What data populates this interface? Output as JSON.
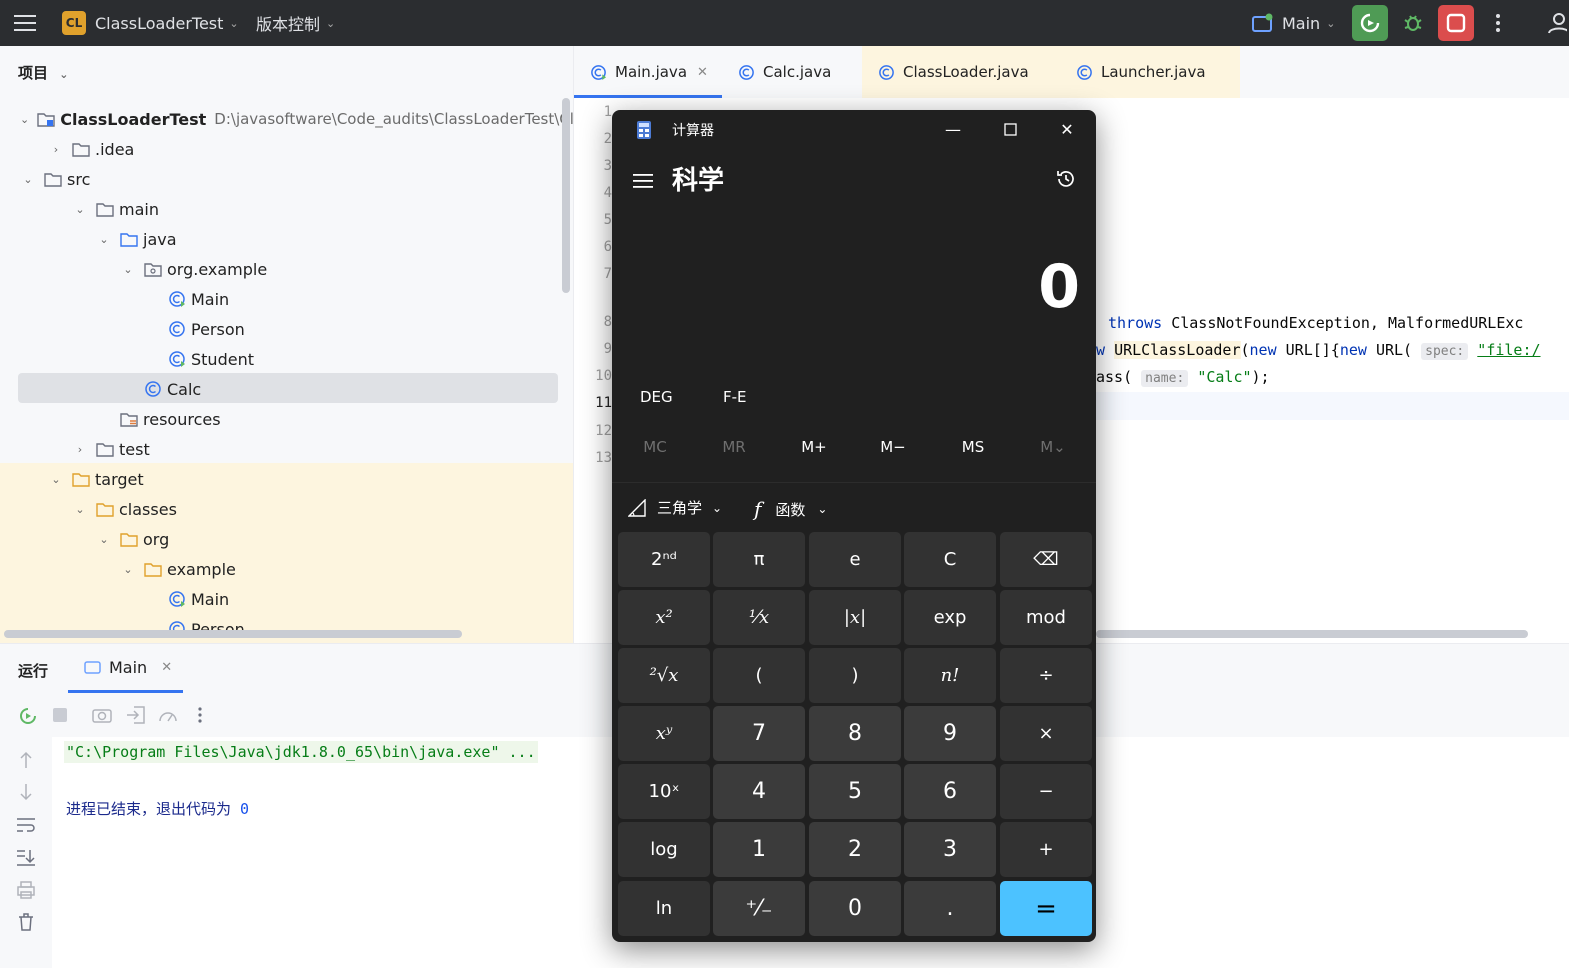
{
  "topbar": {
    "project_badge": "CL",
    "project_name": "ClassLoaderTest",
    "vcs": "版本控制",
    "run_config": "Main"
  },
  "project_panel": {
    "header": "项目",
    "root_name": "ClassLoaderTest",
    "root_path": "D:\\javasoftware\\Code_audits\\ClassLoaderTest\\ClassL",
    "tree": [
      {
        "label": ".idea",
        "icon": "folder-icon",
        "arrow": "›"
      },
      {
        "label": "src",
        "icon": "folder-icon",
        "arrow": "⌄"
      },
      {
        "label": "main",
        "icon": "folder-icon",
        "arrow": "⌄"
      },
      {
        "label": "java",
        "icon": "source-folder-icon",
        "arrow": "⌄"
      },
      {
        "label": "org.example",
        "icon": "package-icon",
        "arrow": "⌄"
      },
      {
        "label": "Main",
        "icon": "main-class-icon",
        "arrow": ""
      },
      {
        "label": "Person",
        "icon": "class-icon",
        "arrow": ""
      },
      {
        "label": "Student",
        "icon": "main-class-icon",
        "arrow": ""
      },
      {
        "label": "Calc",
        "icon": "class-icon",
        "arrow": ""
      },
      {
        "label": "resources",
        "icon": "resources-folder-icon",
        "arrow": ""
      },
      {
        "label": "test",
        "icon": "folder-icon",
        "arrow": "›"
      },
      {
        "label": "target",
        "icon": "excluded-folder-icon",
        "arrow": "⌄"
      },
      {
        "label": "classes",
        "icon": "excluded-folder-icon",
        "arrow": "⌄"
      },
      {
        "label": "org",
        "icon": "excluded-folder-icon",
        "arrow": "⌄"
      },
      {
        "label": "example",
        "icon": "excluded-folder-icon",
        "arrow": "⌄"
      },
      {
        "label": "Main",
        "icon": "main-class-icon",
        "arrow": ""
      },
      {
        "label": "Person",
        "icon": "class-icon",
        "arrow": ""
      }
    ]
  },
  "editor": {
    "tabs": [
      "Main.java",
      "Calc.java",
      "ClassLoader.java",
      "Launcher.java"
    ],
    "line_numbers": [
      "1",
      "2",
      "3",
      "4",
      "5",
      "6",
      "7",
      "8",
      "9",
      "10",
      "11",
      "12",
      "13"
    ],
    "code": {
      "l8_kw": "throws",
      "l8_rest": " ClassNotFoundException, MalformedURLExc",
      "l9_kw1": "w",
      "l9_cls": "URLClassLoader",
      "l9_a": "(",
      "l9_kw2": "new",
      "l9_b": " URL[]{",
      "l9_kw3": "new",
      "l9_c": " URL(",
      "l9_hint": "spec:",
      "l9_str": "\"file:/",
      "l10_a": "ass(",
      "l10_hint": "name:",
      "l10_str": "\"Calc\"",
      "l10_end": ");"
    }
  },
  "run": {
    "title": "运行",
    "tab": "Main",
    "cmd": "\"C:\\Program Files\\Java\\jdk1.8.0_65\\bin\\java.exe\" ...",
    "exit_text": "进程已结束，退出代码为 ",
    "exit_code": "0"
  },
  "calculator": {
    "title": "计算器",
    "mode": "科学",
    "display": "0",
    "deg": "DEG",
    "fe": "F-E",
    "memory": [
      "MC",
      "MR",
      "M+",
      "M−",
      "MS",
      "M⌄"
    ],
    "trig": "三角学",
    "func": "函数",
    "keys": [
      [
        "2ⁿᵈ",
        "π",
        "e",
        "C",
        "⌫"
      ],
      [
        "x²",
        "¹⁄x",
        "|x|",
        "exp",
        "mod"
      ],
      [
        "²√x",
        "(",
        ")",
        "n!",
        "÷"
      ],
      [
        "xʸ",
        "7",
        "8",
        "9",
        "×"
      ],
      [
        "10ˣ",
        "4",
        "5",
        "6",
        "−"
      ],
      [
        "log",
        "1",
        "2",
        "3",
        "+"
      ],
      [
        "ln",
        "⁺⁄₋",
        "0",
        ".",
        "="
      ]
    ]
  }
}
